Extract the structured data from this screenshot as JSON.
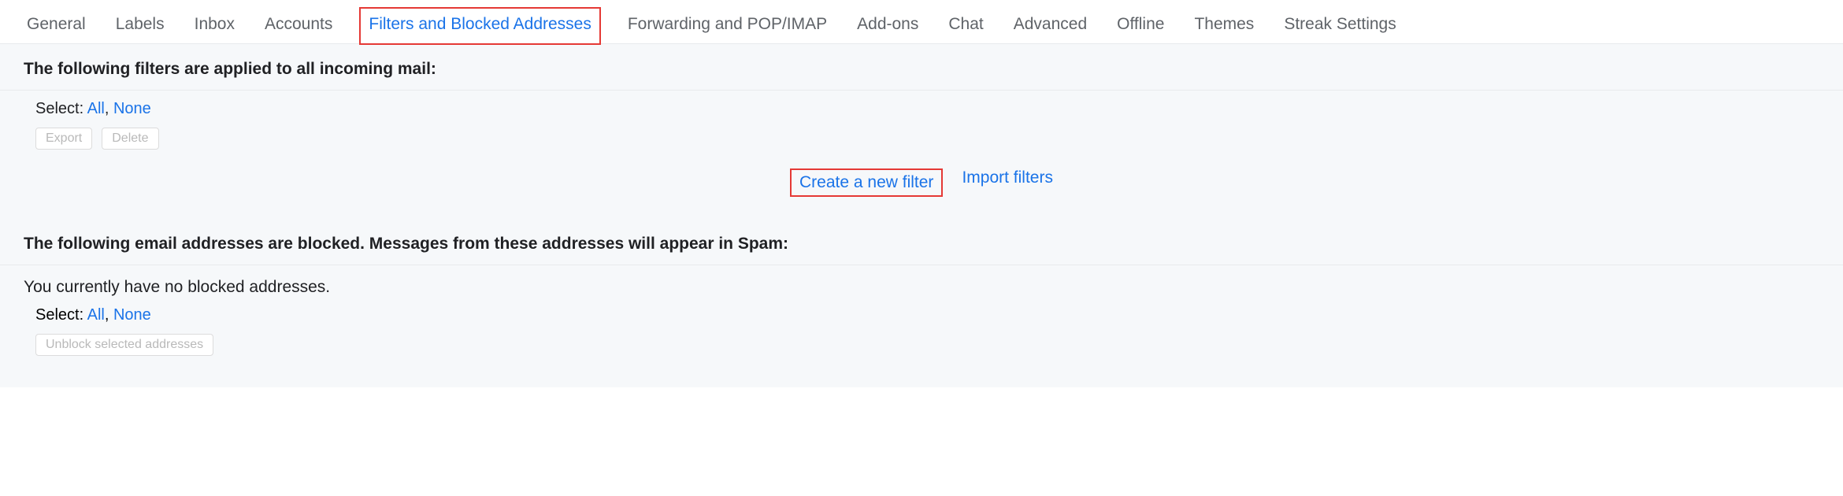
{
  "tabs": {
    "general": "General",
    "labels": "Labels",
    "inbox": "Inbox",
    "accounts": "Accounts",
    "filters": "Filters and Blocked Addresses",
    "forwarding": "Forwarding and POP/IMAP",
    "addons": "Add-ons",
    "chat": "Chat",
    "advanced": "Advanced",
    "offline": "Offline",
    "themes": "Themes",
    "streak": "Streak Settings"
  },
  "filters_section": {
    "header": "The following filters are applied to all incoming mail:",
    "select_label": "Select:",
    "all": "All",
    "none": "None",
    "export": "Export",
    "delete": "Delete",
    "create_filter": "Create a new filter",
    "import_filters": "Import filters"
  },
  "blocked_section": {
    "header": "The following email addresses are blocked. Messages from these addresses will appear in Spam:",
    "no_blocked": "You currently have no blocked addresses.",
    "select_label": "Select:",
    "all": "All",
    "none": "None",
    "unblock": "Unblock selected addresses"
  }
}
